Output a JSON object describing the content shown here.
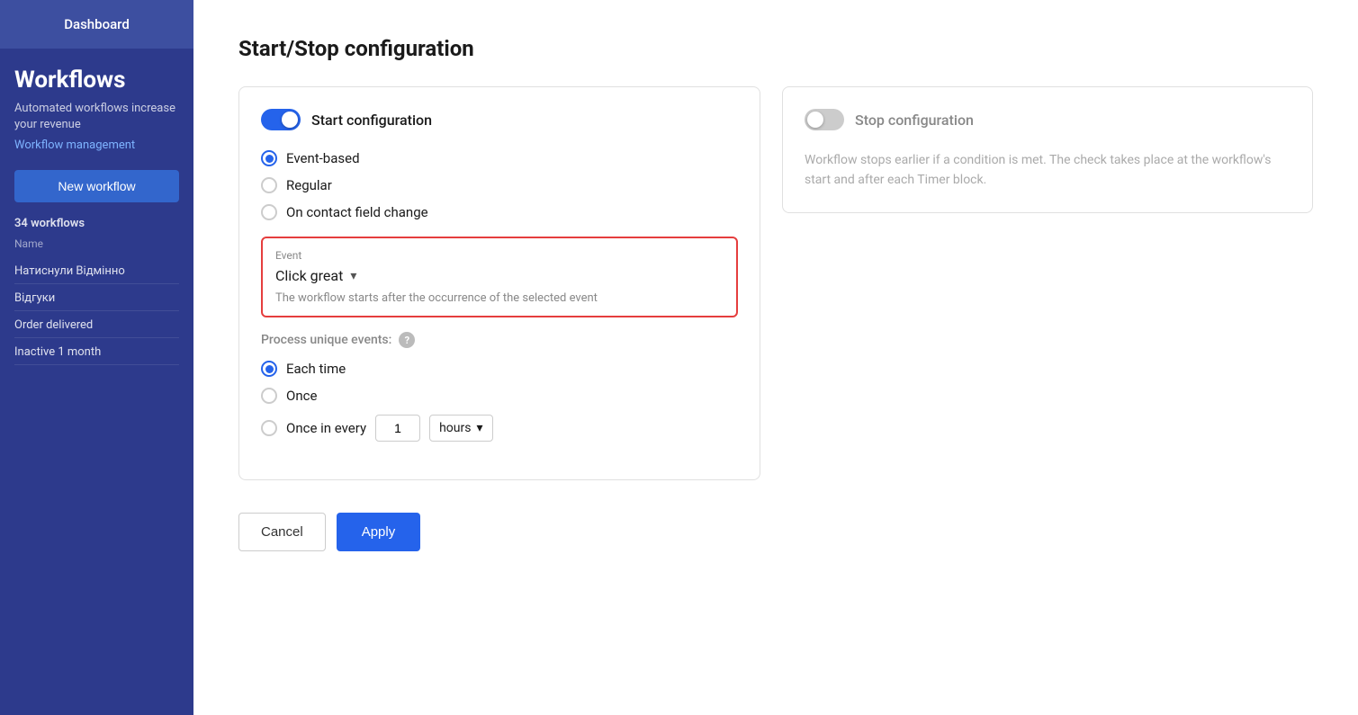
{
  "sidebar": {
    "dashboard_label": "Dashboard",
    "title": "Workflows",
    "description": "Automated workflows increase your revenue",
    "link_text": "Workflow management",
    "new_button_label": "New workflow",
    "workflow_count": "34 workflows",
    "name_col": "Name",
    "items": [
      {
        "label": "Натиснули Відмінно"
      },
      {
        "label": "Відгуки"
      },
      {
        "label": "Order delivered"
      },
      {
        "label": "Inactive 1 month"
      }
    ]
  },
  "page": {
    "title": "Start/Stop configuration"
  },
  "start_card": {
    "toggle_label": "Start configuration",
    "toggle_on": true,
    "radio_options": [
      {
        "label": "Event-based",
        "selected": true
      },
      {
        "label": "Regular",
        "selected": false
      },
      {
        "label": "On contact field change",
        "selected": false
      }
    ],
    "event_box": {
      "label": "Event",
      "value": "Click great",
      "hint": "The workflow starts after the occurrence of the selected event"
    },
    "process_unique_label": "Process unique events:",
    "process_options": [
      {
        "label": "Each time",
        "selected": true
      },
      {
        "label": "Once",
        "selected": false
      },
      {
        "label": "Once in every",
        "selected": false
      }
    ],
    "once_every_value": "1",
    "hours_label": "hours"
  },
  "stop_card": {
    "toggle_label": "Stop configuration",
    "toggle_on": false,
    "description": "Workflow stops earlier if a condition is met. The check takes place at the workflow's start and after each Timer block."
  },
  "footer": {
    "cancel_label": "Cancel",
    "apply_label": "Apply"
  }
}
